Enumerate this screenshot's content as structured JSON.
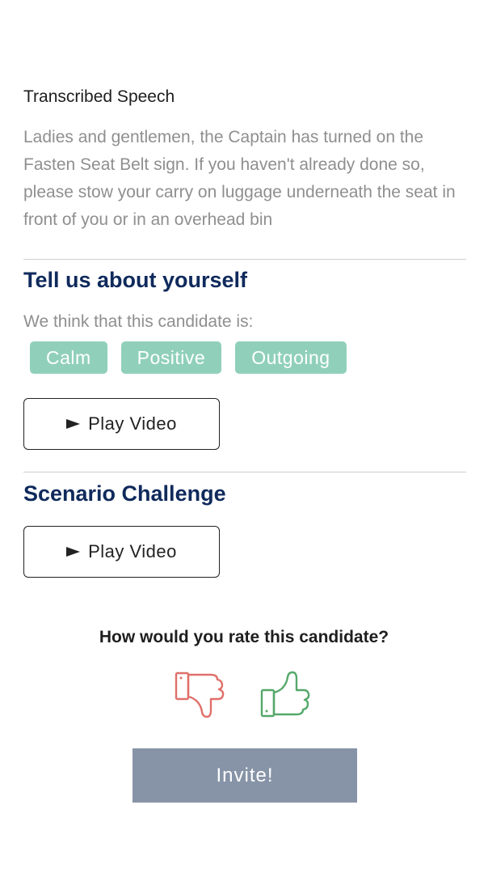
{
  "speech_section": {
    "label": "Transcribed Speech",
    "text": "Ladies and gentlemen, the Captain has turned on the Fasten Seat Belt sign. If you haven't already done so, please stow your carry on luggage underneath the seat in front of you or in an overhead bin"
  },
  "about_section": {
    "heading": "Tell us about yourself",
    "subtext": "We think that this candidate is:",
    "tags": [
      "Calm",
      "Positive",
      "Outgoing"
    ],
    "tag_color": "#90d0bb",
    "play_label": "Play Video"
  },
  "scenario_section": {
    "heading": "Scenario Challenge",
    "play_label": "Play Video"
  },
  "rating": {
    "question": "How would you rate this candidate?",
    "thumbs_down_icon": "thumbs-down-icon",
    "thumbs_up_icon": "thumbs-up-icon",
    "thumbs_down_color": "#e0706a",
    "thumbs_up_color": "#55a86a"
  },
  "invite_button": {
    "label": "Invite!",
    "color": "#8794a7"
  },
  "colors": {
    "heading": "#0f2a5c",
    "muted_text": "#8f8f8f"
  }
}
